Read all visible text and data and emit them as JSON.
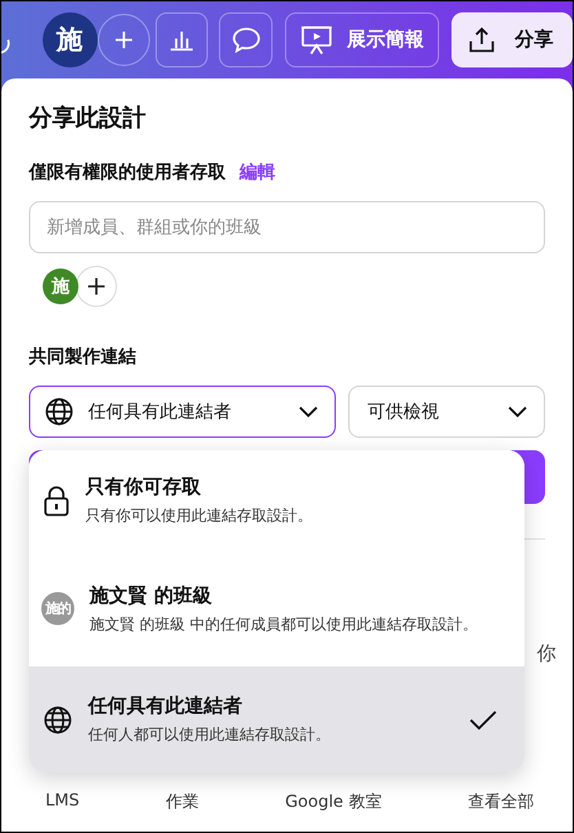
{
  "topbar": {
    "avatar": "施",
    "present_label": "展示簡報",
    "share_label": "分享"
  },
  "panel": {
    "title": "分享此設計",
    "access_label": "僅限有權限的使用者存取",
    "edit_link": "編輯",
    "search": {
      "placeholder": "新增成員、群組或你的班級"
    },
    "member_avatar": "施",
    "section_label": "共同製作連結",
    "link_select": "任何具有此連結者",
    "permission_select": "可供檢視",
    "partial_text": "你",
    "share_targets": [
      "LMS",
      "作業",
      "Google 教室",
      "查看全部"
    ]
  },
  "menu": [
    {
      "kind": "lock",
      "title": "只有你可存取",
      "description": "只有你可以使用此連結存取設計。",
      "selected": false
    },
    {
      "kind": "class",
      "avatar": "施的",
      "title": "施文賢 的班級",
      "description": "施文賢 的班級 中的任何成員都可以使用此連結存取設計。",
      "selected": false
    },
    {
      "kind": "globe",
      "title": "任何具有此連結者",
      "description": "任何人都可以使用此連結存取設計。",
      "selected": true
    }
  ]
}
